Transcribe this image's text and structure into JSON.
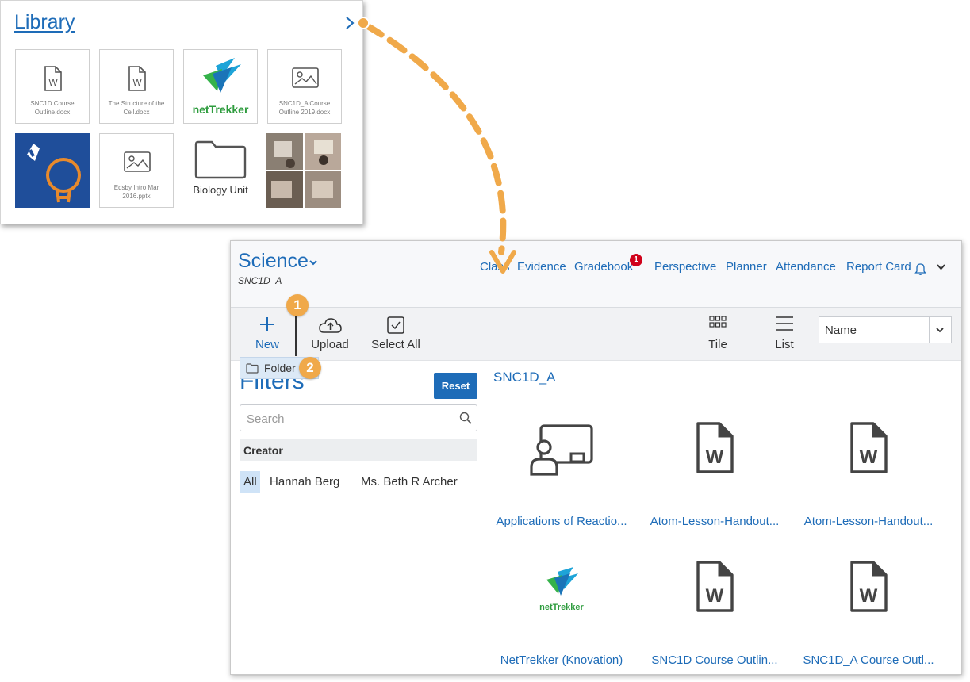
{
  "library": {
    "title": "Library",
    "tiles": [
      {
        "kind": "word-doc",
        "caption": "SNC1D Course Outline.docx"
      },
      {
        "kind": "word-doc",
        "caption": "The Structure of the Cell.docx"
      },
      {
        "kind": "nettrekker-logo",
        "caption": "netTrekker"
      },
      {
        "kind": "image",
        "caption": "SNC1D_A Course Outline 2019.docx"
      },
      {
        "kind": "lightbulb-image",
        "caption": ""
      },
      {
        "kind": "image",
        "caption": "Edsby Intro Mar 2016.pptx"
      },
      {
        "kind": "folder",
        "caption": "Biology Unit"
      },
      {
        "kind": "photo-collage",
        "caption": ""
      }
    ]
  },
  "app": {
    "course_title": "Science",
    "course_code": "SNC1D_A",
    "nav": [
      "Class",
      "Evidence",
      "Gradebook",
      "Perspective",
      "Planner",
      "Attendance",
      "Report Card"
    ],
    "gradebook_badge": "1",
    "toolbar": {
      "new": "New",
      "upload": "Upload",
      "select_all": "Select All",
      "tile": "Tile",
      "list": "List",
      "sort_value": "Name"
    },
    "folder_menu_item": "Folder",
    "callouts": [
      "1",
      "2"
    ],
    "filters": {
      "title": "Filters",
      "reset": "Reset",
      "search_placeholder": "Search",
      "creator_header": "Creator",
      "creators": [
        "All",
        "Hannah Berg",
        "Ms. Beth R Archer"
      ]
    },
    "section_title": "SNC1D_A",
    "items": [
      {
        "icon": "presentation-icon",
        "name": "Applications of Reactio..."
      },
      {
        "icon": "word-doc-icon",
        "name": "Atom-Lesson-Handout..."
      },
      {
        "icon": "word-doc-icon",
        "name": "Atom-Lesson-Handout..."
      },
      {
        "icon": "nettrekker-logo",
        "name": "NetTrekker (Knovation)"
      },
      {
        "icon": "word-doc-icon",
        "name": "SNC1D Course Outlin..."
      },
      {
        "icon": "word-doc-icon",
        "name": "SNC1D_A Course Outl..."
      }
    ]
  },
  "colors": {
    "brand_blue": "#1e6cb8",
    "callout_orange": "#f0a94a",
    "badge_red": "#d0021b"
  }
}
